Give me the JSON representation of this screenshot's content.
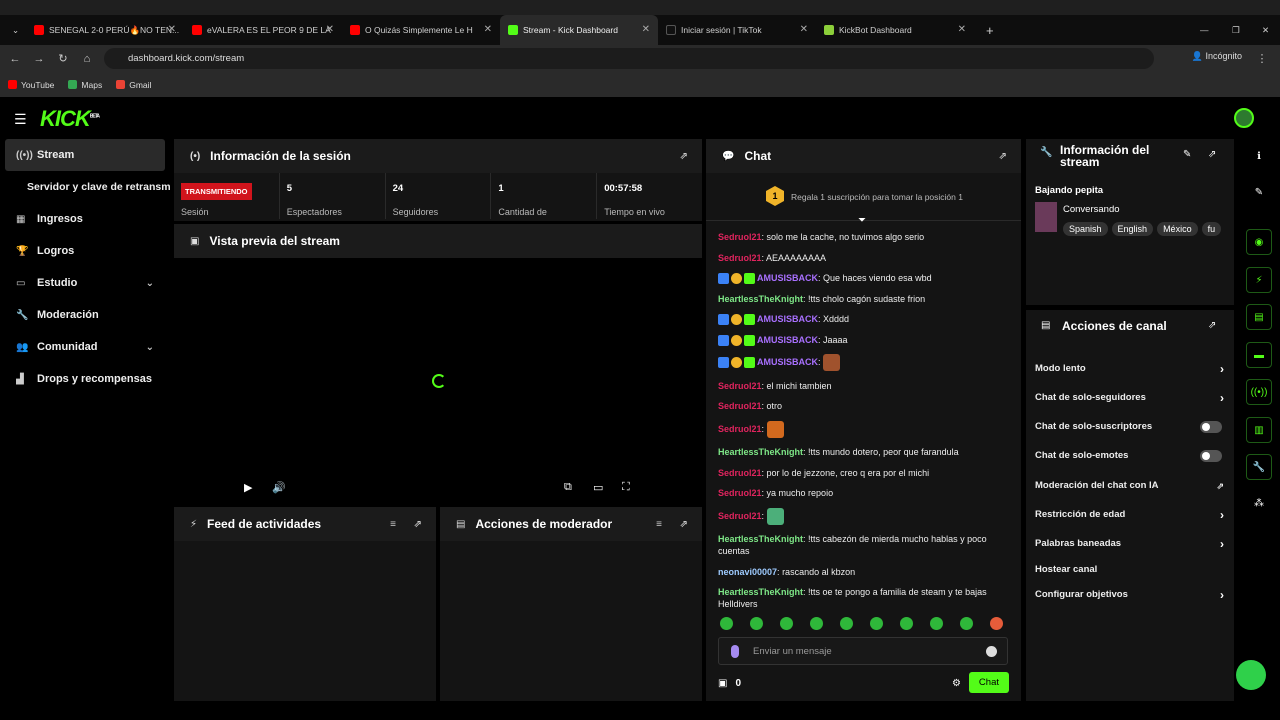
{
  "browser": {
    "tabs": [
      {
        "title": "SENEGAL 2-0 PERÚ🔥NO TEN...",
        "fav": "#ff0000"
      },
      {
        "title": "eVALERA ES EL PEOR 9 DE LA",
        "fav": "#ff0000"
      },
      {
        "title": "O Quizás Simplemente Le H",
        "fav": "#ff0000"
      },
      {
        "title": "Stream - Kick Dashboard",
        "fav": "#53fc18"
      },
      {
        "title": "Iniciar sesión | TikTok",
        "fav": "#111111"
      },
      {
        "title": "KickBot Dashboard",
        "fav": "#8ccf3a"
      }
    ],
    "url": "dashboard.kick.com/stream",
    "incognito": "Incógnito",
    "bookmarks": [
      {
        "label": "YouTube",
        "color": "#ff0000"
      },
      {
        "label": "Maps",
        "color": "#34a853"
      },
      {
        "label": "Gmail",
        "color": "#ea4335"
      }
    ]
  },
  "brand": {
    "logo": "KICK",
    "beta": "BETA"
  },
  "sidebar": {
    "items": [
      {
        "label": "Stream",
        "icon": "broadcast-icon"
      },
      {
        "label": "Servidor y clave de retransmisión",
        "icon": ""
      },
      {
        "label": "Ingresos",
        "icon": "chart-icon"
      },
      {
        "label": "Logros",
        "icon": "trophy-icon"
      },
      {
        "label": "Estudio",
        "icon": "studio-icon"
      },
      {
        "label": "Moderación",
        "icon": "wrench-icon"
      },
      {
        "label": "Comunidad",
        "icon": "community-icon"
      },
      {
        "label": "Drops y recompensas",
        "icon": "drops-icon"
      }
    ]
  },
  "session": {
    "title": "Información de la sesión",
    "status": "TRANSMITIENDO",
    "status_label": "Sesión",
    "stats": [
      {
        "value": "5",
        "label": "Espectadores"
      },
      {
        "value": "24",
        "label": "Seguidores"
      },
      {
        "value": "1",
        "label": "Cantidad de"
      },
      {
        "value": "00:57:58",
        "label": "Tiempo en vivo"
      }
    ]
  },
  "preview": {
    "title": "Vista previa del stream"
  },
  "feed": {
    "title": "Feed de actividades"
  },
  "modactions": {
    "title": "Acciones de moderador"
  },
  "chat": {
    "title": "Chat",
    "pinned": "Regala 1 suscripción para tomar la posición 1",
    "medal": "1",
    "messages": [
      {
        "user": "Sedruol21",
        "color": "#e0245e",
        "text": "solo me la cache, no tuvimos algo serio",
        "badges": false
      },
      {
        "user": "Sedruol21",
        "color": "#e0245e",
        "text": "AEAAAAAAAA",
        "badges": false
      },
      {
        "user": "AMUSISBACK",
        "color": "#a970ff",
        "text": "Que haces viendo esa wbd",
        "badges": true
      },
      {
        "user": "HeartlessTheKnight",
        "color": "#7ee787",
        "text": "!tts cholo cagón sudaste frion",
        "badges": false
      },
      {
        "user": "AMUSISBACK",
        "color": "#a970ff",
        "text": "Xdddd",
        "badges": true
      },
      {
        "user": "AMUSISBACK",
        "color": "#a970ff",
        "text": "Jaaaa",
        "badges": true
      },
      {
        "user": "AMUSISBACK",
        "color": "#a970ff",
        "text": "",
        "badges": true,
        "emote": "#a0522d"
      },
      {
        "user": "Sedruol21",
        "color": "#e0245e",
        "text": "el michi tambien",
        "badges": false
      },
      {
        "user": "Sedruol21",
        "color": "#e0245e",
        "text": "otro",
        "badges": false
      },
      {
        "user": "Sedruol21",
        "color": "#e0245e",
        "text": "",
        "badges": false,
        "emote": "#d2691e"
      },
      {
        "user": "HeartlessTheKnight",
        "color": "#7ee787",
        "text": "!tts mundo dotero, peor que farandula",
        "badges": false
      },
      {
        "user": "Sedruol21",
        "color": "#e0245e",
        "text": "por lo de jezzone, creo q era por el michi",
        "badges": false
      },
      {
        "user": "Sedruol21",
        "color": "#e0245e",
        "text": "ya mucho repoio",
        "badges": false
      },
      {
        "user": "Sedruol21",
        "color": "#e0245e",
        "text": "",
        "badges": false,
        "emote": "#4caf7a"
      },
      {
        "user": "HeartlessTheKnight",
        "color": "#7ee787",
        "text": "!tts cabezón de mierda mucho hablas y poco cuentas",
        "badges": false
      },
      {
        "user": "neonavi00007",
        "color": "#9ecbff",
        "text": "rascando al kbzon",
        "badges": false
      },
      {
        "user": "HeartlessTheKnight",
        "color": "#7ee787",
        "text": "!tts oe te pongo a familia de steam y te bajas Helldivers",
        "badges": false
      }
    ],
    "input_placeholder": "Enviar un mensaje",
    "points": "0",
    "send": "Chat"
  },
  "info": {
    "title": "Información del stream",
    "stream_title": "Bajando pepita",
    "category": "Conversando",
    "tags": [
      "Spanish",
      "English",
      "México",
      "fu"
    ]
  },
  "actions": {
    "title": "Acciones de canal",
    "items": [
      {
        "label": "Modo lento",
        "type": "chevron"
      },
      {
        "label": "Chat de solo-seguidores",
        "type": "chevron"
      },
      {
        "label": "Chat de solo-suscriptores",
        "type": "toggle"
      },
      {
        "label": "Chat de solo-emotes",
        "type": "toggle"
      },
      {
        "label": "Moderación del chat con IA",
        "type": "external"
      },
      {
        "label": "Restricción de edad",
        "type": "chevron"
      },
      {
        "label": "Palabras baneadas",
        "type": "chevron"
      },
      {
        "label": "Hostear canal",
        "type": "none"
      },
      {
        "label": "Configurar objetivos",
        "type": "chevron"
      }
    ]
  }
}
